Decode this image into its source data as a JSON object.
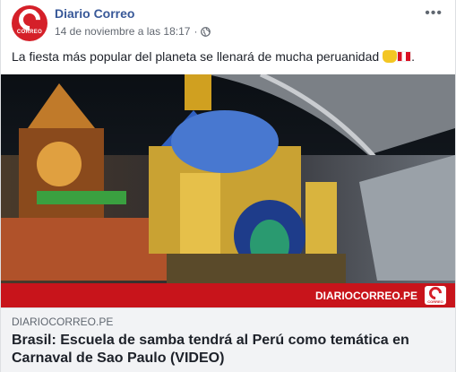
{
  "post": {
    "page_name": "Diario Correo",
    "avatar_word": "CORREO",
    "timestamp": "14 de noviembre a las 18:17",
    "separator": "·",
    "privacy_icon": "globe-icon",
    "more_label": "•••",
    "text": "La fiesta más popular del planeta se llenará de mucha peruanidad",
    "emojis": [
      "raised-hands-emoji",
      "peru-flag-emoji"
    ],
    "text_end": "."
  },
  "image": {
    "banner_text": "DIARIOCORREO.PE",
    "banner_logo_word": "CORREO"
  },
  "link": {
    "domain": "DIARIOCORREO.PE",
    "headline": "Brasil: Escuela de samba tendrá al Perú como temática en Carnaval de Sao Paulo (VIDEO)"
  },
  "colors": {
    "brand_red": "#d52029",
    "link_blue": "#385898"
  }
}
